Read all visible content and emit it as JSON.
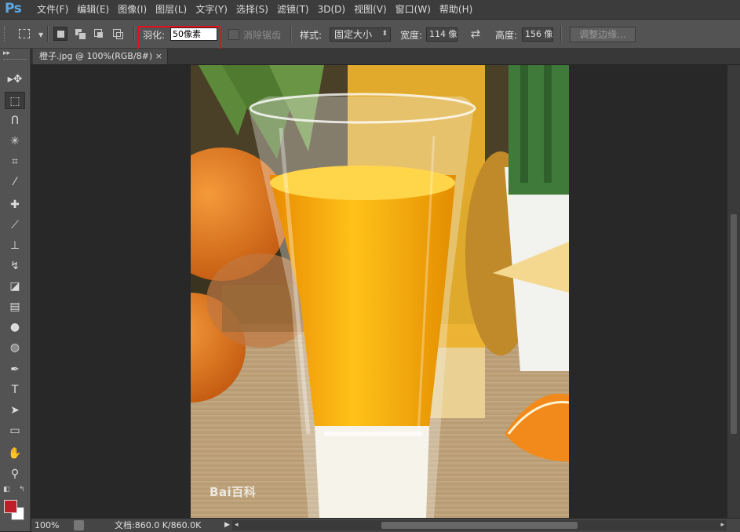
{
  "app": {
    "logo": "Ps"
  },
  "menu": [
    {
      "label": "文件(F)"
    },
    {
      "label": "编辑(E)"
    },
    {
      "label": "图像(I)"
    },
    {
      "label": "图层(L)"
    },
    {
      "label": "文字(Y)"
    },
    {
      "label": "选择(S)"
    },
    {
      "label": "滤镜(T)"
    },
    {
      "label": "3D(D)"
    },
    {
      "label": "视图(V)"
    },
    {
      "label": "窗口(W)"
    },
    {
      "label": "帮助(H)"
    }
  ],
  "options": {
    "feather_label": "羽化:",
    "feather_value": "50像素",
    "antialias_label": "消除锯齿",
    "style_label": "样式:",
    "style_value": "固定大小",
    "width_label": "宽度:",
    "width_value": "114 像",
    "height_label": "高度:",
    "height_value": "156 像",
    "refine_edge_label": "调整边缘..."
  },
  "document": {
    "tab_title": "橙子.jpg @ 100%(RGB/8#)",
    "close_glyph": "×",
    "watermark": "Bai百科"
  },
  "tools": [
    {
      "icon": "move-tool-icon",
      "glyph": "▸✥"
    },
    {
      "icon": "rect-marquee-icon",
      "glyph": "⬚",
      "active": true
    },
    {
      "icon": "lasso-icon",
      "glyph": "ᑎ"
    },
    {
      "icon": "magic-wand-icon",
      "glyph": "✳"
    },
    {
      "icon": "crop-icon",
      "glyph": "⌗"
    },
    {
      "icon": "eyedropper-icon",
      "glyph": "⁄"
    },
    {
      "icon": "healing-brush-icon",
      "glyph": "✚"
    },
    {
      "icon": "brush-icon",
      "glyph": "⟋"
    },
    {
      "icon": "clone-stamp-icon",
      "glyph": "⊥"
    },
    {
      "icon": "history-brush-icon",
      "glyph": "↯"
    },
    {
      "icon": "eraser-icon",
      "glyph": "◪"
    },
    {
      "icon": "gradient-icon",
      "glyph": "▤"
    },
    {
      "icon": "blur-icon",
      "glyph": "●"
    },
    {
      "icon": "dodge-icon",
      "glyph": "◍"
    },
    {
      "icon": "pen-icon",
      "glyph": "✒"
    },
    {
      "icon": "type-icon",
      "glyph": "T"
    },
    {
      "icon": "path-select-icon",
      "glyph": "➤"
    },
    {
      "icon": "shape-icon",
      "glyph": "▭"
    },
    {
      "icon": "hand-icon",
      "glyph": "✋"
    },
    {
      "icon": "zoom-icon",
      "glyph": "⚲"
    }
  ],
  "colors": {
    "foreground": "#c01f2a",
    "background": "#ffffff",
    "highlight": "#e5101a"
  },
  "status": {
    "zoom": "100%",
    "doc_size": "文档:860.0 K/860.0K"
  }
}
